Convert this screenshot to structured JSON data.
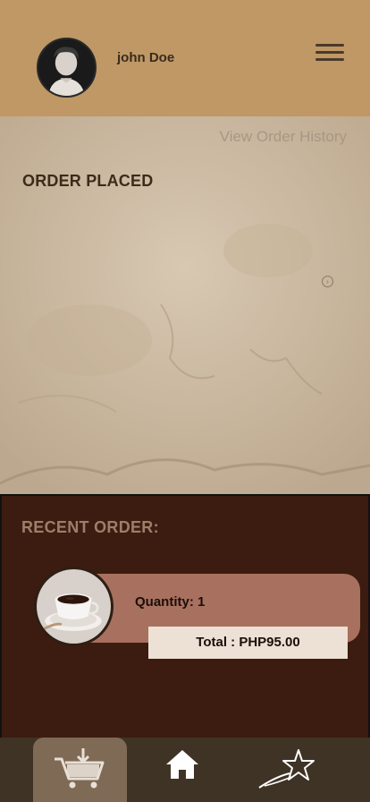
{
  "header": {
    "user_name": "john Doe"
  },
  "main": {
    "history_link": "View Order History",
    "status_title": "ORDER PLACED"
  },
  "recent_order": {
    "title": "RECENT ORDER:",
    "quantity": "Quantity: 1",
    "total": "Total : PHP95.00"
  },
  "nav": {
    "items": [
      {
        "name": "cart",
        "icon": "cart-download-icon",
        "active": true
      },
      {
        "name": "home",
        "icon": "home-icon",
        "active": false
      },
      {
        "name": "rewards",
        "icon": "shooting-star-icon",
        "active": false
      }
    ]
  },
  "colors": {
    "header_bg": "#bf9866",
    "panel_bg": "#3c1c10",
    "card_bg": "#a8705e",
    "nav_bg": "#3f3325",
    "nav_active": "#7f6a55"
  }
}
